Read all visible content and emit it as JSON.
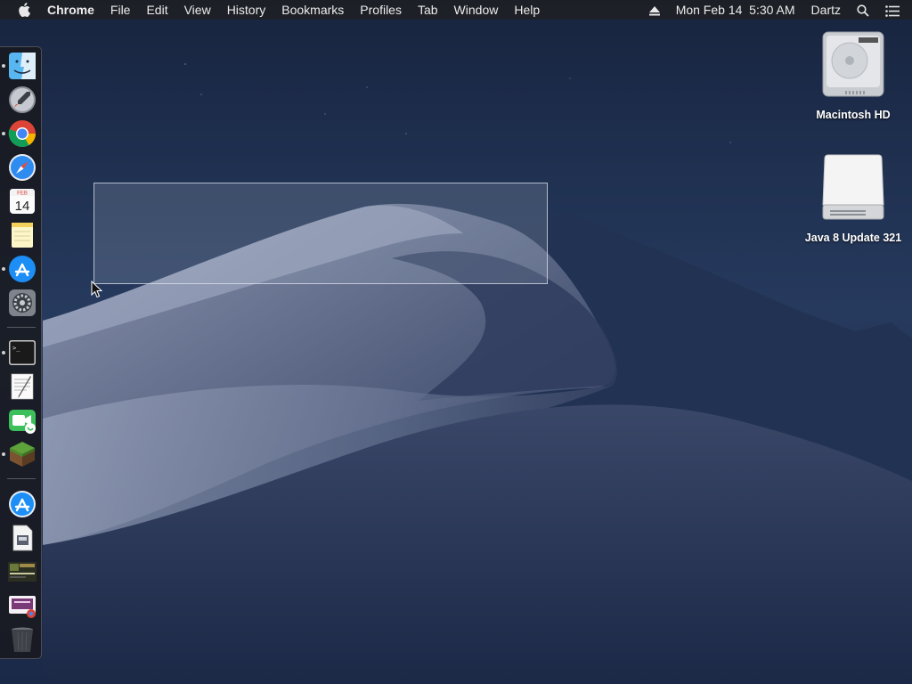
{
  "menubar": {
    "apple_icon": "apple-logo",
    "app_name": "Chrome",
    "menus": [
      "File",
      "Edit",
      "View",
      "History",
      "Bookmarks",
      "Profiles",
      "Tab",
      "Window",
      "Help"
    ],
    "status": {
      "eject_icon": "eject-icon",
      "datetime": "Mon Feb 14  5:30 AM",
      "user": "Dartz",
      "search_icon": "spotlight-search-icon",
      "notification_icon": "notification-center-icon"
    }
  },
  "dock": {
    "position": "left",
    "items": [
      {
        "name": "Finder",
        "icon": "finder-icon",
        "running": true
      },
      {
        "name": "Launchpad",
        "icon": "launchpad-icon",
        "running": false
      },
      {
        "name": "Google Chrome",
        "icon": "chrome-icon",
        "running": true
      },
      {
        "name": "Safari",
        "icon": "safari-icon",
        "running": false
      },
      {
        "name": "Calendar",
        "icon": "calendar-icon",
        "running": false,
        "badge_month": "FEB",
        "badge_day": "14"
      },
      {
        "name": "Notes",
        "icon": "notes-icon",
        "running": false
      },
      {
        "name": "App Store",
        "icon": "app-store-icon",
        "running": true
      },
      {
        "name": "System Preferences",
        "icon": "system-preferences-icon",
        "running": false
      },
      {
        "name": "Terminal",
        "icon": "terminal-icon",
        "running": true
      },
      {
        "name": "TextEdit",
        "icon": "textedit-icon",
        "running": false
      },
      {
        "name": "FaceTime",
        "icon": "facetime-icon",
        "running": false
      },
      {
        "name": "Minecraft",
        "icon": "minecraft-icon",
        "running": true
      },
      {
        "name": "App Store Download",
        "icon": "app-store-icon",
        "running": false
      },
      {
        "name": "Installer",
        "icon": "installer-icon",
        "running": false
      },
      {
        "name": "Screenshot",
        "icon": "screenshot-thumbnail-icon",
        "running": false
      },
      {
        "name": "Chrome App",
        "icon": "chrome-app-shortcut-icon",
        "running": false
      },
      {
        "name": "Trash",
        "icon": "trash-icon",
        "running": false
      }
    ]
  },
  "desktop": {
    "icons": [
      {
        "label": "Macintosh HD",
        "icon": "hard-drive-icon"
      },
      {
        "label": "Java 8 Update 321",
        "icon": "removable-disk-icon"
      }
    ]
  },
  "colors": {
    "menubar_bg": "#1e2024",
    "sky_top": "#1a2847",
    "dune_light": "#7f8aa8",
    "selection_fill": "#aab4c8"
  }
}
